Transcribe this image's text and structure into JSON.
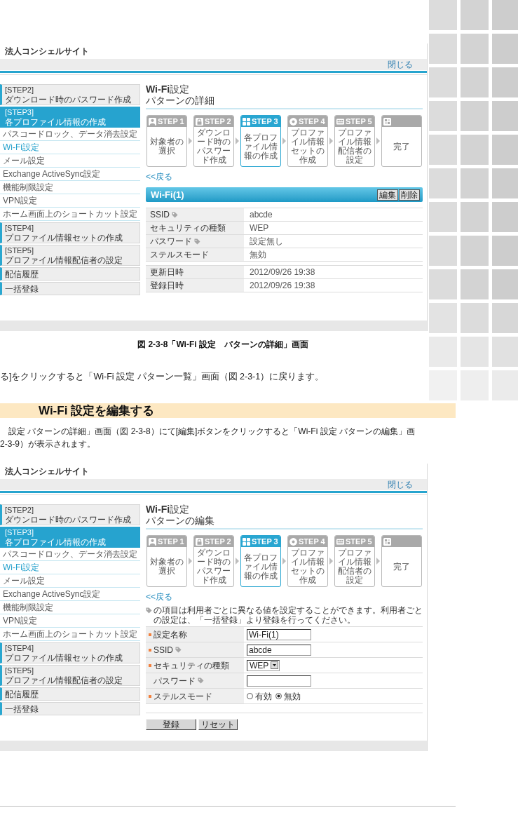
{
  "figure_1": {
    "site_title": "法人コンシェルサイト",
    "close_link": "閉じる",
    "sidebar": [
      {
        "kind": "step",
        "step": "[STEP2]",
        "title": "ダウンロード時のパスワード作成",
        "selected": false
      },
      {
        "kind": "step",
        "step": "[STEP3]",
        "title": "各プロファイル情報の作成",
        "selected": true
      },
      {
        "kind": "sub",
        "label": "パスコードロック、データ消去設定",
        "selected": false
      },
      {
        "kind": "sub",
        "label": "Wi-Fi設定",
        "selected": true
      },
      {
        "kind": "sub",
        "label": "メール設定",
        "selected": false
      },
      {
        "kind": "sub",
        "label": "Exchange ActiveSync設定",
        "selected": false
      },
      {
        "kind": "sub",
        "label": "機能制限設定",
        "selected": false
      },
      {
        "kind": "sub",
        "label": "VPN設定",
        "selected": false
      },
      {
        "kind": "sub",
        "label": "ホーム画面上のショートカット設定",
        "selected": false
      },
      {
        "kind": "step",
        "step": "[STEP4]",
        "title": "プロファイル情報セットの作成",
        "selected": false
      },
      {
        "kind": "step",
        "step": "[STEP5]",
        "title": "プロファイル情報配信者の設定",
        "selected": false
      },
      {
        "kind": "menu",
        "label": "配信履歴",
        "selected": false
      },
      {
        "kind": "menu",
        "label": "一括登録",
        "selected": false
      }
    ],
    "page_title": "**Wi-Fi**設定",
    "page_subtitle": "パターンの詳細",
    "steps": [
      {
        "label": "STEP 1",
        "caption": "対象者の選択",
        "selected": false
      },
      {
        "label": "STEP 2",
        "caption": "ダウンロード時のパスワード作成",
        "selected": false
      },
      {
        "label": "STEP 3",
        "caption": "各プロファイル情報の作成",
        "selected": true
      },
      {
        "label": "STEP 4",
        "caption": "プロファイル情報セットの作成",
        "selected": false
      },
      {
        "label": "STEP 5",
        "caption": "プロファイル情報配信者の設定",
        "selected": false
      },
      {
        "caption": "完了",
        "selected": false
      }
    ],
    "back_link": "<<戻る",
    "panel": {
      "title": "Wi-Fi(1)",
      "buttons": [
        "編集",
        "削除"
      ],
      "rows": [
        {
          "label": "SSID",
          "tag": true,
          "value": "abcde"
        },
        {
          "label": "セキュリティの種類",
          "tag": false,
          "value": "WEP"
        },
        {
          "label": "パスワード",
          "tag": true,
          "value": "設定無し"
        },
        {
          "label": "ステルスモード",
          "tag": false,
          "value": "無効"
        }
      ],
      "timestamps": [
        {
          "label": "更新日時",
          "tag": false,
          "value": "2012/09/26 19:38"
        },
        {
          "label": "登録日時",
          "tag": false,
          "value": "2012/09/26 19:38"
        }
      ]
    }
  },
  "caption": "図 2-3-8「Wi-Fi 設定　パターンの詳細」画面",
  "paragraph_1": "る]をクリックすると「Wi-Fi 設定 パターン一覧」画面（図 2-3-1）に戻ります。",
  "section_heading": "Wi-Fi 設定を編集する",
  "paragraph_2": [
    "設定 パターンの詳細」画面（図 2-3-8）にて[編集]ボタンをクリックすると「Wi-Fi 設定 パターンの編集」画",
    "2-3-9）が表示されます。"
  ],
  "figure_2": {
    "site_title": "法人コンシェルサイト",
    "close_link": "閉じる",
    "sidebar": [
      {
        "kind": "step",
        "step": "[STEP2]",
        "title": "ダウンロード時のパスワード作成",
        "selected": false
      },
      {
        "kind": "step",
        "step": "[STEP3]",
        "title": "各プロファイル情報の作成",
        "selected": true
      },
      {
        "kind": "sub",
        "label": "パスコードロック、データ消去設定",
        "selected": false
      },
      {
        "kind": "sub",
        "label": "Wi-Fi設定",
        "selected": true
      },
      {
        "kind": "sub",
        "label": "メール設定",
        "selected": false
      },
      {
        "kind": "sub",
        "label": "Exchange ActiveSync設定",
        "selected": false
      },
      {
        "kind": "sub",
        "label": "機能制限設定",
        "selected": false
      },
      {
        "kind": "sub",
        "label": "VPN設定",
        "selected": false
      },
      {
        "kind": "sub",
        "label": "ホーム画面上のショートカット設定",
        "selected": false
      },
      {
        "kind": "step",
        "step": "[STEP4]",
        "title": "プロファイル情報セットの作成",
        "selected": false
      },
      {
        "kind": "step",
        "step": "[STEP5]",
        "title": "プロファイル情報配信者の設定",
        "selected": false
      },
      {
        "kind": "menu",
        "label": "配信履歴",
        "selected": false
      },
      {
        "kind": "menu",
        "label": "一括登録",
        "selected": false
      }
    ],
    "page_title": "**Wi-Fi**設定",
    "page_subtitle": "パターンの編集",
    "steps": [
      {
        "label": "STEP 1",
        "caption": "対象者の選択",
        "selected": false
      },
      {
        "label": "STEP 2",
        "caption": "ダウンロード時のパスワード作成",
        "selected": false
      },
      {
        "label": "STEP 3",
        "caption": "各プロファイル情報の作成",
        "selected": true
      },
      {
        "label": "STEP 4",
        "caption": "プロファイル情報セットの作成",
        "selected": false
      },
      {
        "label": "STEP 5",
        "caption": "プロファイル情報配信者の設定",
        "selected": false
      },
      {
        "caption": "完了",
        "selected": false
      }
    ],
    "back_link": "<<戻る",
    "note": "の項目は利用者ごとに異なる値を設定することができます。利用者ごとの設定は、「一括登録」より登録を行ってください。",
    "form": {
      "rows": [
        {
          "kind": "text",
          "label": "設定名称",
          "required": true,
          "tag": false,
          "value": "Wi-Fi(1)"
        },
        {
          "kind": "text",
          "label": "SSID",
          "required": true,
          "tag": true,
          "value": "abcde"
        },
        {
          "kind": "select",
          "label": "セキュリティの種類",
          "required": true,
          "tag": false,
          "value": "WEP"
        },
        {
          "kind": "text",
          "label": "パスワード",
          "required": false,
          "tag": true
        },
        {
          "kind": "radio",
          "label": "ステルスモード",
          "required": true,
          "tag": false,
          "options": [
            {
              "label": "有効",
              "selected": false
            },
            {
              "label": "無効",
              "selected": true
            }
          ]
        }
      ],
      "buttons": [
        "登録",
        "リセット"
      ]
    }
  }
}
